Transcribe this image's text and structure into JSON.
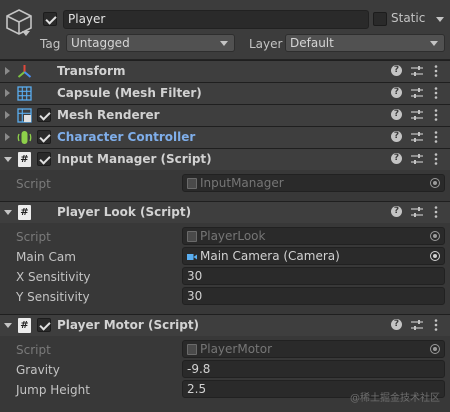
{
  "header": {
    "gameobject_enabled": true,
    "name": "Player",
    "static_label": "Static",
    "static_checked": false,
    "tag_label": "Tag",
    "tag_value": "Untagged",
    "layer_label": "Layer",
    "layer_value": "Default"
  },
  "components": {
    "transform": {
      "title": "Transform"
    },
    "mesh_filter": {
      "title": "Capsule (Mesh Filter)"
    },
    "mesh_renderer": {
      "title": "Mesh Renderer",
      "enabled": true
    },
    "character_controller": {
      "title": "Character Controller",
      "enabled": true
    },
    "input_manager": {
      "title": "Input Manager (Script)",
      "enabled": true,
      "script_label": "Script",
      "script_value": "InputManager"
    },
    "player_look": {
      "title": "Player Look (Script)",
      "script_label": "Script",
      "script_value": "PlayerLook",
      "main_cam_label": "Main Cam",
      "main_cam_value": "Main Camera (Camera)",
      "x_sens_label": "X Sensitivity",
      "x_sens_value": "30",
      "y_sens_label": "Y Sensitivity",
      "y_sens_value": "30"
    },
    "player_motor": {
      "title": "Player Motor (Script)",
      "enabled": true,
      "script_label": "Script",
      "script_value": "PlayerMotor",
      "gravity_label": "Gravity",
      "gravity_value": "-9.8",
      "jump_label": "Jump Height",
      "jump_value": "2.5"
    }
  },
  "header_buttons": {
    "help": "?"
  },
  "script_icon_glyph": "#",
  "watermark": "@稀土掘金技术社区",
  "colors": {
    "panel_bg": "#383838",
    "header_bg": "#3e3e3e",
    "link_blue": "#7faeea",
    "transform_red": "#e0483b",
    "transform_green": "#7cc242",
    "transform_blue": "#4a8ef0",
    "icon_blue": "#5aaef0",
    "controller_green": "#8ed04a"
  },
  "icons": {
    "gameobject": "cube-icon",
    "transform": "transform-axes-icon",
    "mesh_filter": "mesh-grid-icon",
    "mesh_renderer": "mesh-renderer-icon",
    "character_controller": "character-controller-icon",
    "script": "csharp-script-icon",
    "help": "help-icon",
    "presets": "presets-icon",
    "menu": "kebab-menu-icon",
    "object_picker": "object-picker-icon",
    "camera": "camera-icon"
  }
}
